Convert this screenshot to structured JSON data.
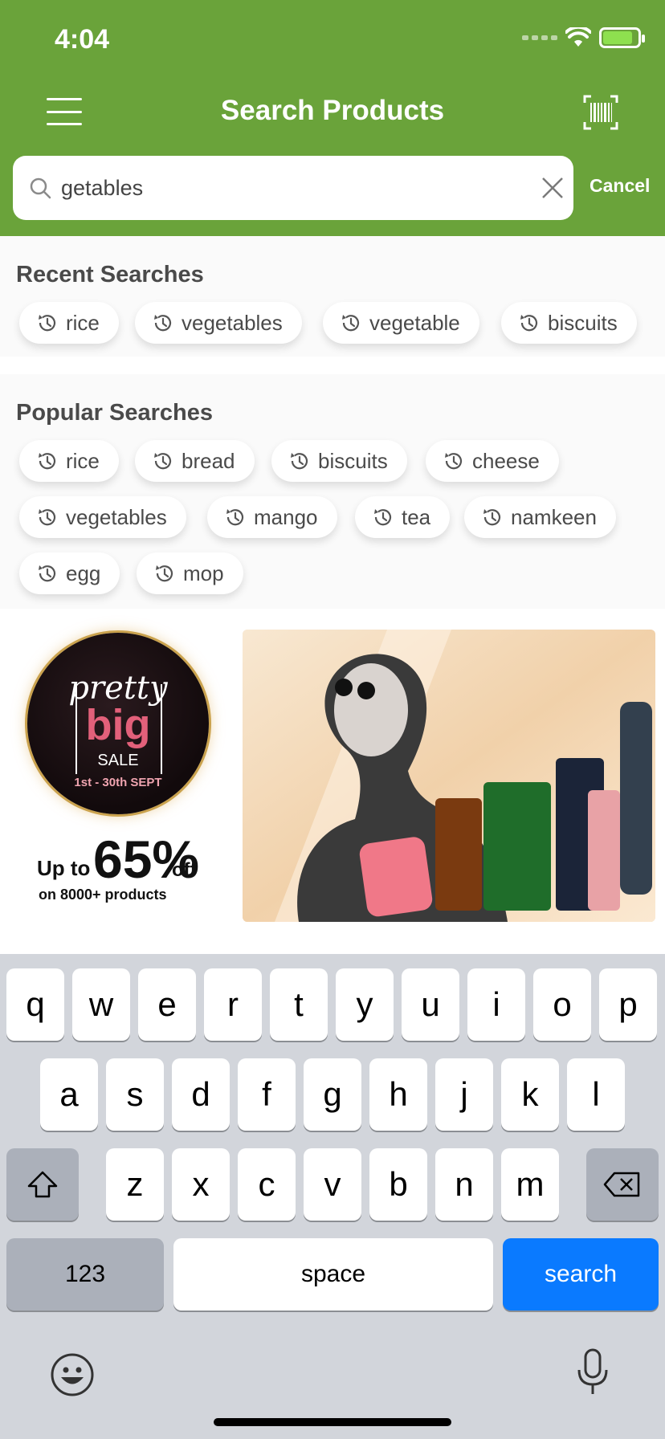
{
  "status_bar": {
    "time": "4:04"
  },
  "header": {
    "title": "Search Products"
  },
  "search": {
    "value": "getables",
    "cancel_label": "Cancel"
  },
  "recent": {
    "title": "Recent Searches",
    "items": [
      "rice",
      "vegetables",
      "vegetable",
      "biscuits"
    ]
  },
  "popular": {
    "title": "Popular Searches",
    "items": [
      "rice",
      "bread",
      "biscuits",
      "cheese",
      "vegetables",
      "mango",
      "tea",
      "namkeen",
      "egg",
      "mop"
    ]
  },
  "banner": {
    "pretty": "pretty",
    "big": "big",
    "sale": "SALE",
    "dates": "1st - 30th SEPT",
    "up_to": "Up to",
    "percent": "65%",
    "off": "off",
    "products": "on 8000+ products"
  },
  "keyboard": {
    "row1": [
      "q",
      "w",
      "e",
      "r",
      "t",
      "y",
      "u",
      "i",
      "o",
      "p"
    ],
    "row2": [
      "a",
      "s",
      "d",
      "f",
      "g",
      "h",
      "j",
      "k",
      "l"
    ],
    "row3": [
      "z",
      "x",
      "c",
      "v",
      "b",
      "n",
      "m"
    ],
    "numbers_label": "123",
    "space_label": "space",
    "search_label": "search"
  },
  "colors": {
    "header_green": "#6aa33a",
    "key_blue": "#0a7aff"
  },
  "icons": [
    "menu-icon",
    "barcode-scan-icon",
    "search-icon",
    "clear-icon",
    "history-icon",
    "shift-icon",
    "backspace-icon",
    "emoji-icon",
    "microphone-icon"
  ]
}
